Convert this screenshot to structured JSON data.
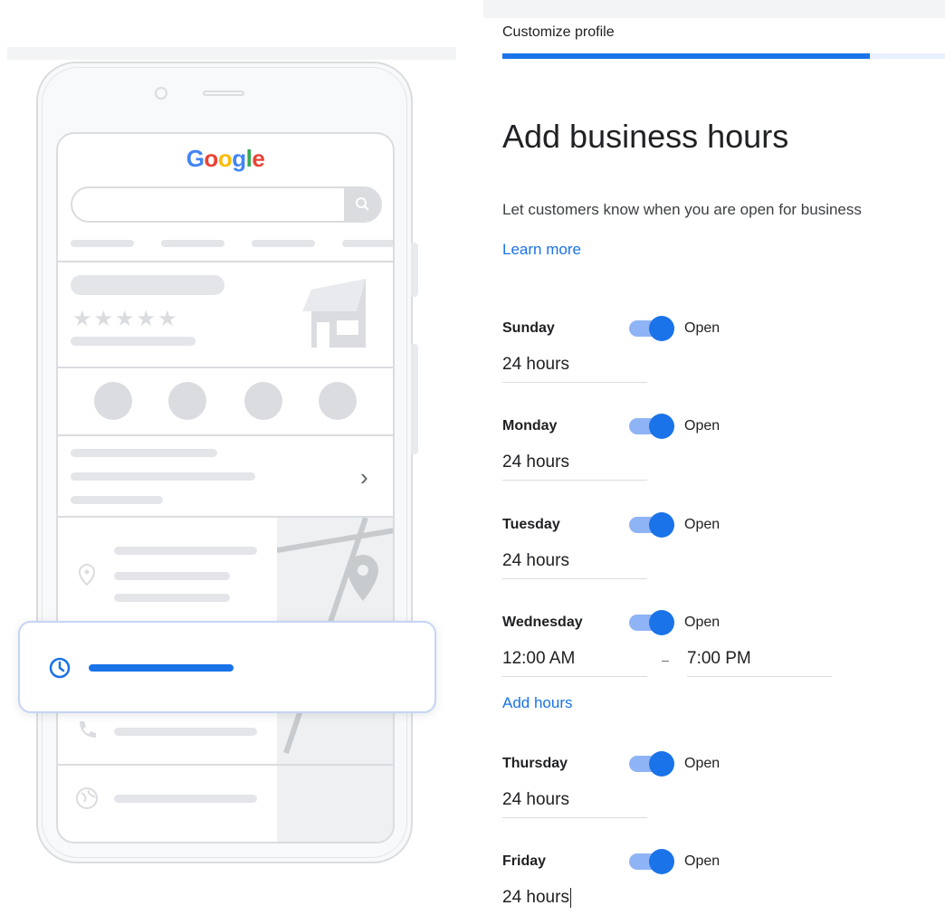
{
  "illustration": {
    "logo_letters": [
      "G",
      "o",
      "o",
      "g",
      "l",
      "e"
    ],
    "rating_stars": "★★★★★",
    "chevron": "›"
  },
  "progress": {
    "label": "Customize profile",
    "fraction": 0.83
  },
  "page": {
    "title": "Add business hours",
    "subtitle": "Let customers know when you are open for business",
    "learn_more": "Learn more",
    "add_hours": "Add hours"
  },
  "days": [
    {
      "name": "Sunday",
      "status": "Open",
      "value": "24 hours"
    },
    {
      "name": "Monday",
      "status": "Open",
      "value": "24 hours"
    },
    {
      "name": "Tuesday",
      "status": "Open",
      "value": "24 hours"
    },
    {
      "name": "Wednesday",
      "status": "Open",
      "open_time": "12:00 AM",
      "close_time": "7:00 PM",
      "separator": "–"
    },
    {
      "name": "Thursday",
      "status": "Open",
      "value": "24 hours"
    },
    {
      "name": "Friday",
      "status": "Open",
      "value": "24 hours"
    }
  ],
  "colors": {
    "accent": "#1a73e8",
    "toggle_track": "#8fb4f5",
    "divider": "#dadce0"
  }
}
